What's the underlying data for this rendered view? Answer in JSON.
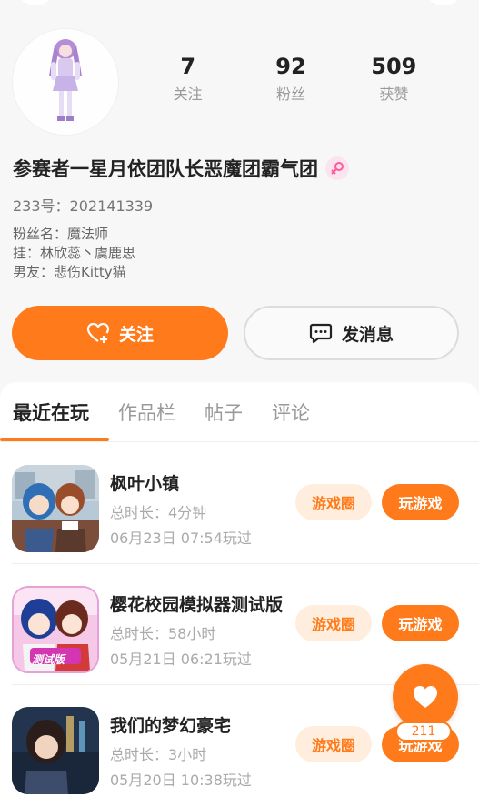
{
  "profile": {
    "stats": [
      {
        "value": "7",
        "label": "关注"
      },
      {
        "value": "92",
        "label": "粉丝"
      },
      {
        "value": "509",
        "label": "获赞"
      }
    ],
    "username": "参赛者一星月依团队长恶魔团霸气团",
    "gender_icon": "female-icon",
    "uid": "233号：202141339",
    "bio_lines": [
      "粉丝名：魔法师",
      "挂：林欣蕊丶虞鹿思",
      "男友：悲伤Kitty猫"
    ]
  },
  "actions": {
    "follow_label": "关注",
    "message_label": "发消息"
  },
  "tabs": [
    {
      "label": "最近在玩",
      "active": true
    },
    {
      "label": "作品栏",
      "active": false
    },
    {
      "label": "帖子",
      "active": false
    },
    {
      "label": "评论",
      "active": false
    }
  ],
  "games": [
    {
      "title": "枫叶小镇",
      "duration": "总时长：4分钟",
      "last_played": "06月23日 07:54玩过",
      "circle_label": "游戏圈",
      "play_label": "玩游戏"
    },
    {
      "title": "樱花校园模拟器测试版",
      "duration": "总时长：58小时",
      "last_played": "05月21日 06:21玩过",
      "circle_label": "游戏圈",
      "play_label": "玩游戏",
      "icon_badge": "测试版"
    },
    {
      "title": "我们的梦幻豪宅",
      "duration": "总时长：3小时",
      "last_played": "05月20日 10:38玩过",
      "circle_label": "游戏圈",
      "play_label": "玩游戏"
    }
  ],
  "like_fab": {
    "count": "211",
    "icon": "heart-icon"
  },
  "colors": {
    "accent": "#ff7a1a",
    "accent_light": "#ffeedd"
  }
}
